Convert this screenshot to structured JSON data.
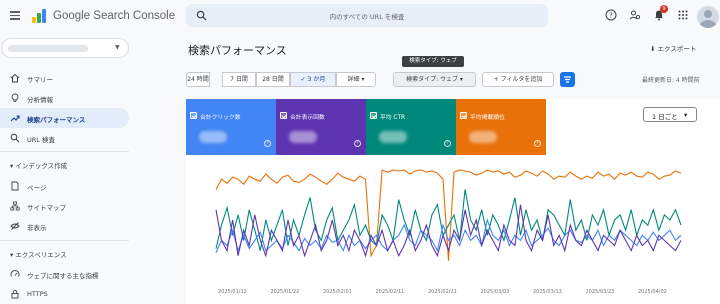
{
  "header": {
    "app_title": "Google Search Console",
    "search_placeholder": "内のすべての URL を検査",
    "notification_count": "9"
  },
  "sidebar": {
    "items": [
      {
        "label": "サマリー",
        "icon": "home-icon"
      },
      {
        "label": "分析情報",
        "icon": "lightbulb-icon"
      },
      {
        "label": "検索パフォーマンス",
        "icon": "trending-up-icon",
        "active": true
      },
      {
        "label": "URL 検査",
        "icon": "search-icon"
      }
    ],
    "section_index": "インデックス作成",
    "index_items": [
      {
        "label": "ページ",
        "icon": "page-icon"
      },
      {
        "label": "サイトマップ",
        "icon": "sitemap-icon"
      },
      {
        "label": "非表示",
        "icon": "hidden-icon"
      }
    ],
    "section_experience": "エクスペリエンス",
    "experience_items": [
      {
        "label": "ウェブに関する主な指標",
        "icon": "speedometer-icon"
      },
      {
        "label": "HTTPS",
        "icon": "lock-icon"
      }
    ]
  },
  "main": {
    "title": "検索パフォーマンス",
    "export_label": "エクスポート",
    "date_chips": [
      "24 時間",
      "7 日間",
      "28 日間",
      "3 か月",
      "詳細"
    ],
    "selected_chip": "3 か月",
    "search_type_chip": "検索タイプ: ウェブ",
    "tooltip": "検索タイプ: ウェブ",
    "add_filter": "フィルタを追加",
    "updated": "最終更新日: 4 時間前",
    "granularity": "1 日ごと"
  },
  "metric_cards": [
    {
      "label": "合計クリック数",
      "color": "#4285f4"
    },
    {
      "label": "合計表示回数",
      "color": "#5e35b1"
    },
    {
      "label": "平均 CTR",
      "color": "#00897b"
    },
    {
      "label": "平均掲載順位",
      "color": "#e8710a"
    }
  ],
  "chart_data": {
    "type": "line",
    "x_ticks": [
      "2025/01/12",
      "2025/01/22",
      "2025/02/01",
      "2025/02/11",
      "2025/02/21",
      "2025/03/03",
      "2025/03/13",
      "2025/03/23",
      "2025/04/02"
    ],
    "y_axis_labels_visible": false,
    "series": [
      {
        "color": "#e8710a",
        "values": [
          0.8,
          0.9,
          0.86,
          0.92,
          0.9,
          0.85,
          0.93,
          0.9,
          0.88,
          0.95,
          0.9,
          0.86,
          0.92,
          0.94,
          0.88,
          0.87,
          0.9,
          0.95,
          0.92,
          0.88,
          0.85,
          0.9,
          0.96,
          0.92,
          0.9,
          0.88,
          0.93,
          0.9,
          0.15,
          0.25,
          0.99,
          0.97,
          0.99,
          0.98,
          0.99,
          0.95,
          0.98,
          0.99,
          0.97,
          0.98,
          0.96,
          0.9,
          0.1,
          0.97,
          0.99,
          0.98,
          0.97,
          0.94,
          0.96,
          0.99,
          0.97,
          0.98,
          0.95,
          0.97,
          0.92,
          0.94,
          0.98,
          0.96,
          0.93,
          0.98,
          0.95,
          0.9,
          0.93,
          0.92,
          0.97,
          0.93,
          0.9,
          0.93,
          0.91,
          0.97,
          0.93,
          0.95,
          0.9,
          0.96,
          0.94,
          0.97,
          0.93,
          0.92,
          0.97,
          0.95,
          0.9,
          0.93,
          0.94,
          0.98,
          0.96
        ]
      },
      {
        "color": "#00897b",
        "values": [
          0.22,
          0.45,
          0.62,
          0.35,
          0.55,
          0.3,
          0.6,
          0.4,
          0.2,
          0.5,
          0.3,
          0.45,
          0.6,
          0.25,
          0.5,
          0.35,
          0.55,
          0.72,
          0.4,
          0.3,
          0.5,
          0.62,
          0.3,
          0.4,
          0.5,
          0.65,
          0.35,
          0.45,
          0.3,
          0.25,
          0.55,
          0.45,
          0.3,
          0.7,
          0.5,
          0.35,
          0.6,
          0.4,
          0.3,
          0.55,
          0.65,
          0.35,
          0.45,
          0.55,
          0.3,
          0.8,
          0.5,
          0.4,
          0.6,
          0.35,
          0.55,
          0.45,
          0.3,
          0.5,
          0.72,
          0.35,
          0.6,
          0.4,
          0.5,
          0.3,
          0.6,
          0.55,
          0.45,
          0.35,
          0.7,
          0.4,
          0.5,
          0.3,
          0.55,
          0.45,
          0.6,
          0.35,
          0.5,
          0.55,
          0.4,
          0.6,
          0.35,
          0.5,
          0.45,
          0.6,
          0.4,
          0.55,
          0.5,
          0.6,
          0.45
        ]
      },
      {
        "color": "#4285f4",
        "values": [
          0.18,
          0.3,
          0.25,
          0.4,
          0.2,
          0.35,
          0.22,
          0.3,
          0.38,
          0.2,
          0.25,
          0.3,
          0.22,
          0.35,
          0.28,
          0.2,
          0.32,
          0.25,
          0.3,
          0.22,
          0.35,
          0.28,
          0.3,
          0.2,
          0.35,
          0.25,
          0.3,
          0.22,
          0.3,
          0.35,
          0.25,
          0.2,
          0.3,
          0.35,
          0.45,
          0.3,
          0.25,
          0.4,
          0.35,
          0.3,
          0.2,
          0.45,
          0.3,
          0.35,
          0.25,
          0.4,
          0.3,
          0.35,
          0.25,
          0.5,
          0.35,
          0.3,
          0.4,
          0.25,
          0.35,
          0.3,
          0.4,
          0.25,
          0.3,
          0.35,
          0.42,
          0.3,
          0.25,
          0.35,
          0.4,
          0.3,
          0.28,
          0.35,
          0.3,
          0.4,
          0.25,
          0.35,
          0.3,
          0.4,
          0.35,
          0.3,
          0.25,
          0.35,
          0.3,
          0.38,
          0.3,
          0.35,
          0.4,
          0.3,
          0.35
        ]
      },
      {
        "color": "#5e35b1",
        "values": [
          0.6,
          0.3,
          0.2,
          0.5,
          0.15,
          0.4,
          0.25,
          0.55,
          0.3,
          0.15,
          0.4,
          0.3,
          0.2,
          0.5,
          0.25,
          0.35,
          0.15,
          0.3,
          0.45,
          0.2,
          0.3,
          0.5,
          0.25,
          0.35,
          0.2,
          0.4,
          0.3,
          0.15,
          0.35,
          0.25,
          0.4,
          0.2,
          0.3,
          0.15,
          0.25,
          0.4,
          0.2,
          0.3,
          0.45,
          0.25,
          0.15,
          0.35,
          0.2,
          0.4,
          0.3,
          0.6,
          0.35,
          0.5,
          0.25,
          0.4,
          0.3,
          0.2,
          0.45,
          0.3,
          0.25,
          0.65,
          0.3,
          0.2,
          0.4,
          0.3,
          0.55,
          0.25,
          0.35,
          0.2,
          0.45,
          0.3,
          0.25,
          0.4,
          0.3,
          0.2,
          0.35,
          0.3,
          0.25,
          0.4,
          0.3,
          0.2,
          0.35,
          0.25,
          0.3,
          0.2,
          0.35,
          0.3,
          0.25,
          0.2,
          0.3
        ]
      }
    ]
  }
}
